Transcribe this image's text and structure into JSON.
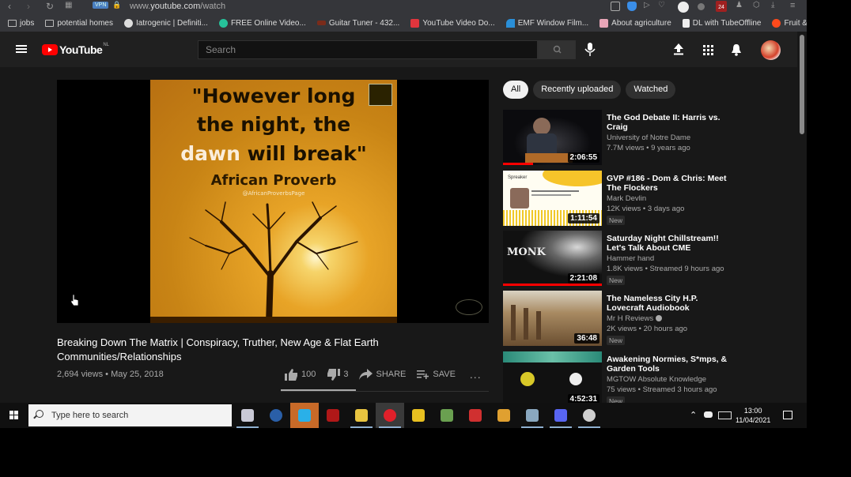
{
  "browser": {
    "url_prefix": "www.",
    "url_domain": "youtube.com",
    "url_path": "/watch",
    "vpn_label": "VPN",
    "bookmarks": [
      {
        "label": "jobs",
        "icon": "folder-icon"
      },
      {
        "label": "potential homes",
        "icon": "folder-icon"
      },
      {
        "label": "Iatrogenic | Definiti...",
        "icon": "site-icon",
        "color": "#dddddd"
      },
      {
        "label": "FREE Online Video...",
        "icon": "site-icon",
        "color": "#26c29a"
      },
      {
        "label": "Guitar Tuner - 432...",
        "icon": "site-icon",
        "color": "#7a2b1a"
      },
      {
        "label": "YouTube Video Do...",
        "icon": "site-icon",
        "color": "#e0353d"
      },
      {
        "label": "EMF Window Film...",
        "icon": "site-icon",
        "color": "#2a8fd8"
      },
      {
        "label": "About agriculture",
        "icon": "site-icon",
        "color": "#e8a6b8"
      },
      {
        "label": "DL with TubeOffline",
        "icon": "document-icon",
        "color": "#eeeeee"
      },
      {
        "label": "Fruit & Veg",
        "icon": "site-icon",
        "color": "#ff4a1c"
      }
    ],
    "bookmarks_overflow": "»",
    "notification_badge": "24"
  },
  "header": {
    "logo_text": "YouTube",
    "country_code": "NL",
    "search_placeholder": "Search"
  },
  "video": {
    "thumbnail_quote": {
      "line1": "\"However long",
      "line2": "the night, the",
      "line3_highlight": "dawn",
      "line3_rest": " will break\"",
      "attribution": "African Proverb",
      "handle": "@AfricanProverbsPage"
    },
    "title": "Breaking Down The Matrix | Conspiracy, Truther, New Age & Flat Earth Communities/Relationships",
    "views": "2,694 views",
    "date": "May 25, 2018",
    "likes": "100",
    "dislikes": "3",
    "like_ratio": 0.97,
    "share_label": "SHARE",
    "save_label": "SAVE",
    "more_label": "..."
  },
  "filters": {
    "chips": [
      {
        "label": "All",
        "active": true
      },
      {
        "label": "Recently uploaded",
        "active": false
      },
      {
        "label": "Watched",
        "active": false
      }
    ]
  },
  "recommendations": [
    {
      "title": "The God Debate II: Harris vs. Craig",
      "channel": "University of Notre Dame",
      "verified": false,
      "meta": "7.7M views • 9 years ago",
      "duration": "2:06:55",
      "badge": "",
      "watched_progress": 0.3
    },
    {
      "title": "GVP #186 - Dom & Chris: Meet The Flockers",
      "channel": "Mark Devlin",
      "verified": false,
      "meta": "12K views • 3 days ago",
      "duration": "1:11:54",
      "badge": "New",
      "watched_progress": 0
    },
    {
      "title": "Saturday Night Chillstream!! Let's Talk About CME",
      "channel": "Hammer hand",
      "verified": false,
      "meta": "1.8K views • Streamed 9 hours ago",
      "duration": "2:21:08",
      "badge": "New",
      "watched_progress": 1.0
    },
    {
      "title": "The Nameless City H.P. Lovecraft Audiobook",
      "channel": "Mr H Reviews",
      "verified": true,
      "meta": "2K views • 20 hours ago",
      "duration": "36:48",
      "badge": "New",
      "watched_progress": 0
    },
    {
      "title": "Awakening Normies, S*mps, & Garden Tools",
      "channel": "MGTOW Absolute Knowledge",
      "verified": false,
      "meta": "75 views • Streamed 3 hours ago",
      "duration": "4:52:31",
      "badge": "New",
      "watched_progress": 0
    }
  ],
  "taskbar": {
    "search_placeholder": "Type here to search",
    "time": "13:00",
    "date": "11/04/2021",
    "apps": [
      {
        "name": "app-satellite",
        "color": "#c9c9d6",
        "running": true,
        "active": false
      },
      {
        "name": "app-steam",
        "color": "#2a5fa8",
        "running": false,
        "active": false
      },
      {
        "name": "app-cube",
        "color": "#2ab0e8",
        "running": false,
        "active": true
      },
      {
        "name": "app-red-book",
        "color": "#b01818",
        "running": false,
        "active": false
      },
      {
        "name": "app-file-explorer",
        "color": "#e8c440",
        "running": true,
        "active": false
      },
      {
        "name": "app-opera",
        "color": "#e0202a",
        "running": true,
        "active": true
      },
      {
        "name": "app-star",
        "color": "#e8c020",
        "running": false,
        "active": false
      },
      {
        "name": "app-green",
        "color": "#6aa050",
        "running": false,
        "active": false
      },
      {
        "name": "app-red-triangle",
        "color": "#d03030",
        "running": false,
        "active": false
      },
      {
        "name": "app-rl",
        "color": "#e0a030",
        "running": false,
        "active": false
      },
      {
        "name": "app-monitor",
        "color": "#8aa8c0",
        "running": true,
        "active": false
      },
      {
        "name": "app-discord",
        "color": "#5865f2",
        "running": true,
        "active": false
      },
      {
        "name": "app-obs",
        "color": "#cfcfcf",
        "running": true,
        "active": false
      }
    ]
  }
}
